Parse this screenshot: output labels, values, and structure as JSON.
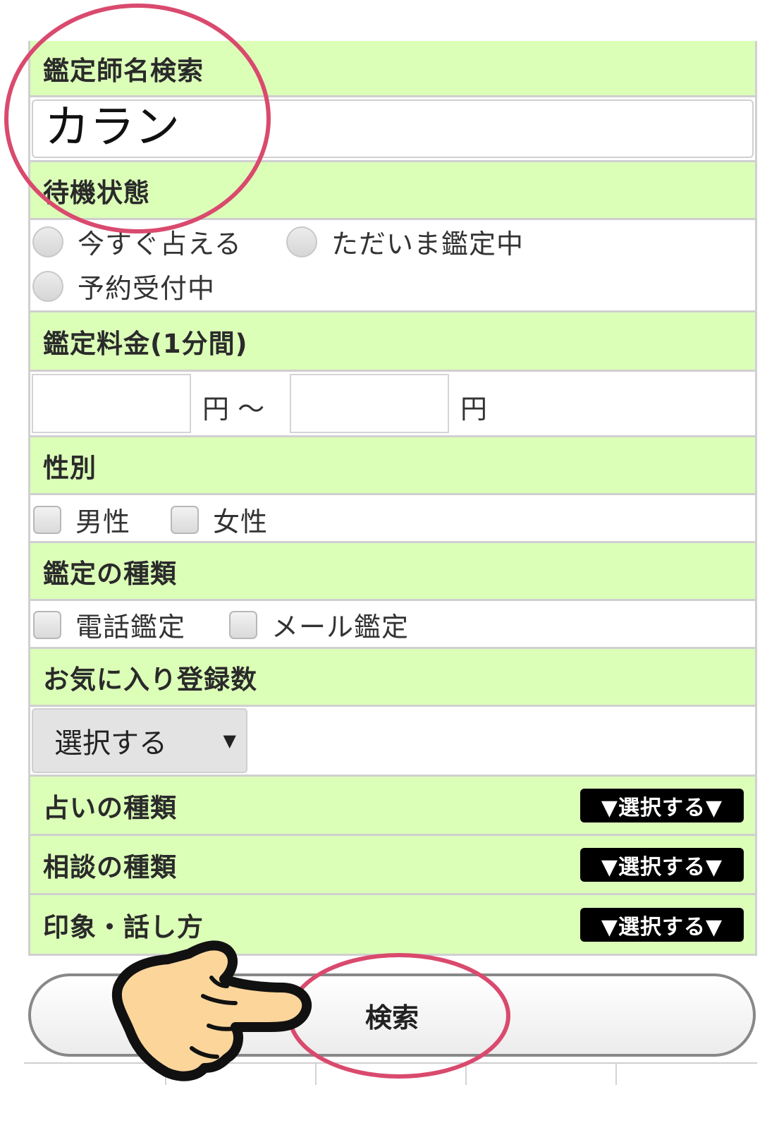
{
  "name_search": {
    "heading": "鑑定師名検索",
    "value": "カラン"
  },
  "status": {
    "heading": "待機状態",
    "options": [
      "今すぐ占える",
      "ただいま鑑定中",
      "予約受付中"
    ]
  },
  "fee": {
    "heading": "鑑定料金(1分間)",
    "unit_from": "円 ～",
    "unit_to": "円"
  },
  "gender": {
    "heading": "性別",
    "options": [
      "男性",
      "女性"
    ]
  },
  "reading_type": {
    "heading": "鑑定の種類",
    "options": [
      "電話鑑定",
      "メール鑑定"
    ]
  },
  "favorites": {
    "heading": "お気に入り登録数",
    "select_value": "選択する",
    "select_arrow": "▼"
  },
  "divination_type": {
    "heading": "占いの種類",
    "button": "▼選択する▼"
  },
  "consultation_type": {
    "heading": "相談の種類",
    "button": "▼選択する▼"
  },
  "impression": {
    "heading": "印象・話し方",
    "button": "▼選択する▼"
  },
  "search_button": {
    "label": "検索"
  },
  "colors": {
    "section_header_bg": "#dcffb8",
    "highlight_ring": "#d94a6e",
    "hand_fill": "#fcd59b"
  }
}
